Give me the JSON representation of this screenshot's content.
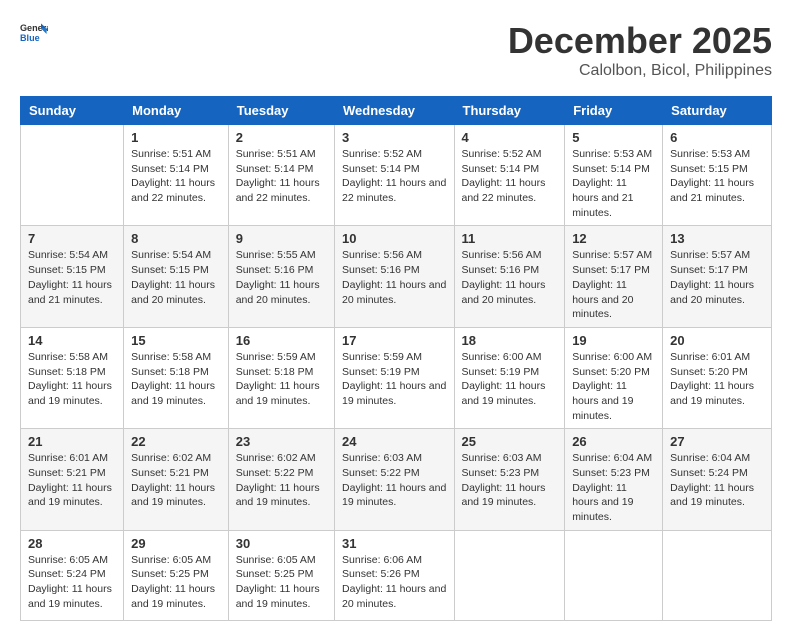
{
  "header": {
    "logo_general": "General",
    "logo_blue": "Blue",
    "month_title": "December 2025",
    "location": "Calolbon, Bicol, Philippines"
  },
  "weekdays": [
    "Sunday",
    "Monday",
    "Tuesday",
    "Wednesday",
    "Thursday",
    "Friday",
    "Saturday"
  ],
  "weeks": [
    [
      {
        "day": "",
        "sunrise": "",
        "sunset": "",
        "daylight": ""
      },
      {
        "day": "1",
        "sunrise": "Sunrise: 5:51 AM",
        "sunset": "Sunset: 5:14 PM",
        "daylight": "Daylight: 11 hours and 22 minutes."
      },
      {
        "day": "2",
        "sunrise": "Sunrise: 5:51 AM",
        "sunset": "Sunset: 5:14 PM",
        "daylight": "Daylight: 11 hours and 22 minutes."
      },
      {
        "day": "3",
        "sunrise": "Sunrise: 5:52 AM",
        "sunset": "Sunset: 5:14 PM",
        "daylight": "Daylight: 11 hours and 22 minutes."
      },
      {
        "day": "4",
        "sunrise": "Sunrise: 5:52 AM",
        "sunset": "Sunset: 5:14 PM",
        "daylight": "Daylight: 11 hours and 22 minutes."
      },
      {
        "day": "5",
        "sunrise": "Sunrise: 5:53 AM",
        "sunset": "Sunset: 5:14 PM",
        "daylight": "Daylight: 11 hours and 21 minutes."
      },
      {
        "day": "6",
        "sunrise": "Sunrise: 5:53 AM",
        "sunset": "Sunset: 5:15 PM",
        "daylight": "Daylight: 11 hours and 21 minutes."
      }
    ],
    [
      {
        "day": "7",
        "sunrise": "Sunrise: 5:54 AM",
        "sunset": "Sunset: 5:15 PM",
        "daylight": "Daylight: 11 hours and 21 minutes."
      },
      {
        "day": "8",
        "sunrise": "Sunrise: 5:54 AM",
        "sunset": "Sunset: 5:15 PM",
        "daylight": "Daylight: 11 hours and 20 minutes."
      },
      {
        "day": "9",
        "sunrise": "Sunrise: 5:55 AM",
        "sunset": "Sunset: 5:16 PM",
        "daylight": "Daylight: 11 hours and 20 minutes."
      },
      {
        "day": "10",
        "sunrise": "Sunrise: 5:56 AM",
        "sunset": "Sunset: 5:16 PM",
        "daylight": "Daylight: 11 hours and 20 minutes."
      },
      {
        "day": "11",
        "sunrise": "Sunrise: 5:56 AM",
        "sunset": "Sunset: 5:16 PM",
        "daylight": "Daylight: 11 hours and 20 minutes."
      },
      {
        "day": "12",
        "sunrise": "Sunrise: 5:57 AM",
        "sunset": "Sunset: 5:17 PM",
        "daylight": "Daylight: 11 hours and 20 minutes."
      },
      {
        "day": "13",
        "sunrise": "Sunrise: 5:57 AM",
        "sunset": "Sunset: 5:17 PM",
        "daylight": "Daylight: 11 hours and 20 minutes."
      }
    ],
    [
      {
        "day": "14",
        "sunrise": "Sunrise: 5:58 AM",
        "sunset": "Sunset: 5:18 PM",
        "daylight": "Daylight: 11 hours and 19 minutes."
      },
      {
        "day": "15",
        "sunrise": "Sunrise: 5:58 AM",
        "sunset": "Sunset: 5:18 PM",
        "daylight": "Daylight: 11 hours and 19 minutes."
      },
      {
        "day": "16",
        "sunrise": "Sunrise: 5:59 AM",
        "sunset": "Sunset: 5:18 PM",
        "daylight": "Daylight: 11 hours and 19 minutes."
      },
      {
        "day": "17",
        "sunrise": "Sunrise: 5:59 AM",
        "sunset": "Sunset: 5:19 PM",
        "daylight": "Daylight: 11 hours and 19 minutes."
      },
      {
        "day": "18",
        "sunrise": "Sunrise: 6:00 AM",
        "sunset": "Sunset: 5:19 PM",
        "daylight": "Daylight: 11 hours and 19 minutes."
      },
      {
        "day": "19",
        "sunrise": "Sunrise: 6:00 AM",
        "sunset": "Sunset: 5:20 PM",
        "daylight": "Daylight: 11 hours and 19 minutes."
      },
      {
        "day": "20",
        "sunrise": "Sunrise: 6:01 AM",
        "sunset": "Sunset: 5:20 PM",
        "daylight": "Daylight: 11 hours and 19 minutes."
      }
    ],
    [
      {
        "day": "21",
        "sunrise": "Sunrise: 6:01 AM",
        "sunset": "Sunset: 5:21 PM",
        "daylight": "Daylight: 11 hours and 19 minutes."
      },
      {
        "day": "22",
        "sunrise": "Sunrise: 6:02 AM",
        "sunset": "Sunset: 5:21 PM",
        "daylight": "Daylight: 11 hours and 19 minutes."
      },
      {
        "day": "23",
        "sunrise": "Sunrise: 6:02 AM",
        "sunset": "Sunset: 5:22 PM",
        "daylight": "Daylight: 11 hours and 19 minutes."
      },
      {
        "day": "24",
        "sunrise": "Sunrise: 6:03 AM",
        "sunset": "Sunset: 5:22 PM",
        "daylight": "Daylight: 11 hours and 19 minutes."
      },
      {
        "day": "25",
        "sunrise": "Sunrise: 6:03 AM",
        "sunset": "Sunset: 5:23 PM",
        "daylight": "Daylight: 11 hours and 19 minutes."
      },
      {
        "day": "26",
        "sunrise": "Sunrise: 6:04 AM",
        "sunset": "Sunset: 5:23 PM",
        "daylight": "Daylight: 11 hours and 19 minutes."
      },
      {
        "day": "27",
        "sunrise": "Sunrise: 6:04 AM",
        "sunset": "Sunset: 5:24 PM",
        "daylight": "Daylight: 11 hours and 19 minutes."
      }
    ],
    [
      {
        "day": "28",
        "sunrise": "Sunrise: 6:05 AM",
        "sunset": "Sunset: 5:24 PM",
        "daylight": "Daylight: 11 hours and 19 minutes."
      },
      {
        "day": "29",
        "sunrise": "Sunrise: 6:05 AM",
        "sunset": "Sunset: 5:25 PM",
        "daylight": "Daylight: 11 hours and 19 minutes."
      },
      {
        "day": "30",
        "sunrise": "Sunrise: 6:05 AM",
        "sunset": "Sunset: 5:25 PM",
        "daylight": "Daylight: 11 hours and 19 minutes."
      },
      {
        "day": "31",
        "sunrise": "Sunrise: 6:06 AM",
        "sunset": "Sunset: 5:26 PM",
        "daylight": "Daylight: 11 hours and 20 minutes."
      },
      {
        "day": "",
        "sunrise": "",
        "sunset": "",
        "daylight": ""
      },
      {
        "day": "",
        "sunrise": "",
        "sunset": "",
        "daylight": ""
      },
      {
        "day": "",
        "sunrise": "",
        "sunset": "",
        "daylight": ""
      }
    ]
  ]
}
